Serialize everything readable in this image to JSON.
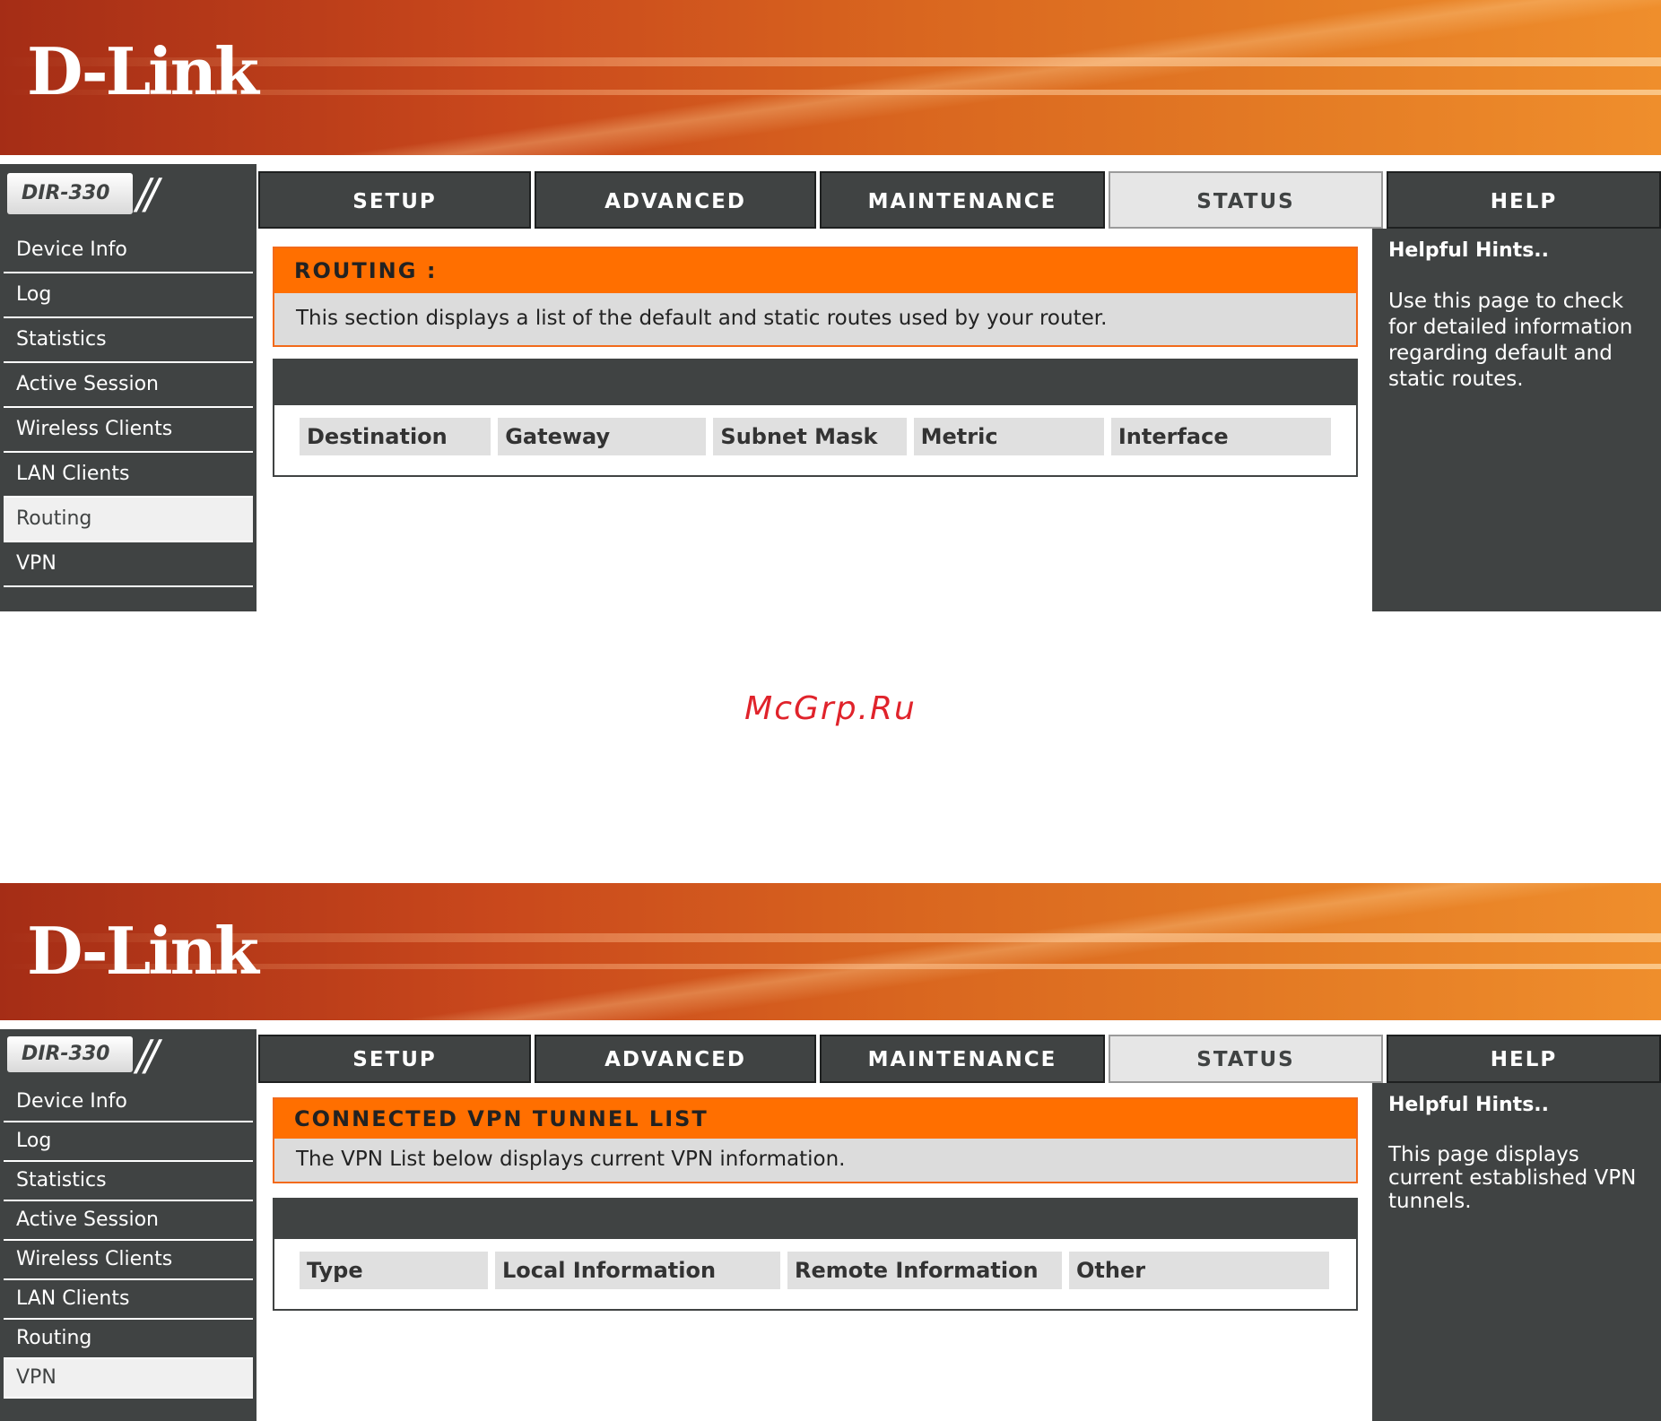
{
  "watermark": "McGrp.Ru",
  "screens": [
    {
      "brand": "D-Link",
      "model": "DIR-330",
      "tabs": [
        "SETUP",
        "ADVANCED",
        "MAINTENANCE",
        "STATUS",
        "HELP"
      ],
      "active_tab": "STATUS",
      "sidebar": [
        "Device Info",
        "Log",
        "Statistics",
        "Active Session",
        "Wireless Clients",
        "LAN Clients",
        "Routing",
        "VPN"
      ],
      "active_sidebar": "Routing",
      "section_title": "ROUTING :",
      "section_desc": "This section displays a list of the default and static routes used by your router.",
      "columns": [
        "Destination",
        "Gateway",
        "Subnet Mask",
        "Metric",
        "Interface"
      ],
      "hints_title": "Helpful Hints..",
      "hints_body": "Use this page to check for detailed information regarding default and static routes."
    },
    {
      "brand": "D-Link",
      "model": "DIR-330",
      "tabs": [
        "SETUP",
        "ADVANCED",
        "MAINTENANCE",
        "STATUS",
        "HELP"
      ],
      "active_tab": "STATUS",
      "sidebar": [
        "Device Info",
        "Log",
        "Statistics",
        "Active Session",
        "Wireless Clients",
        "LAN Clients",
        "Routing",
        "VPN"
      ],
      "active_sidebar": "VPN",
      "section_title": "CONNECTED VPN TUNNEL LIST",
      "section_desc": "The VPN List below displays current VPN information.",
      "columns": [
        "Type",
        "Local Information",
        "Remote Information",
        "Other"
      ],
      "hints_title": "Helpful Hints..",
      "hints_body": "This page displays current established VPN tunnels."
    }
  ],
  "colors": {
    "accent_orange": "#ff6f00",
    "nav_dark": "#404343",
    "watermark_red": "#e0232b"
  }
}
